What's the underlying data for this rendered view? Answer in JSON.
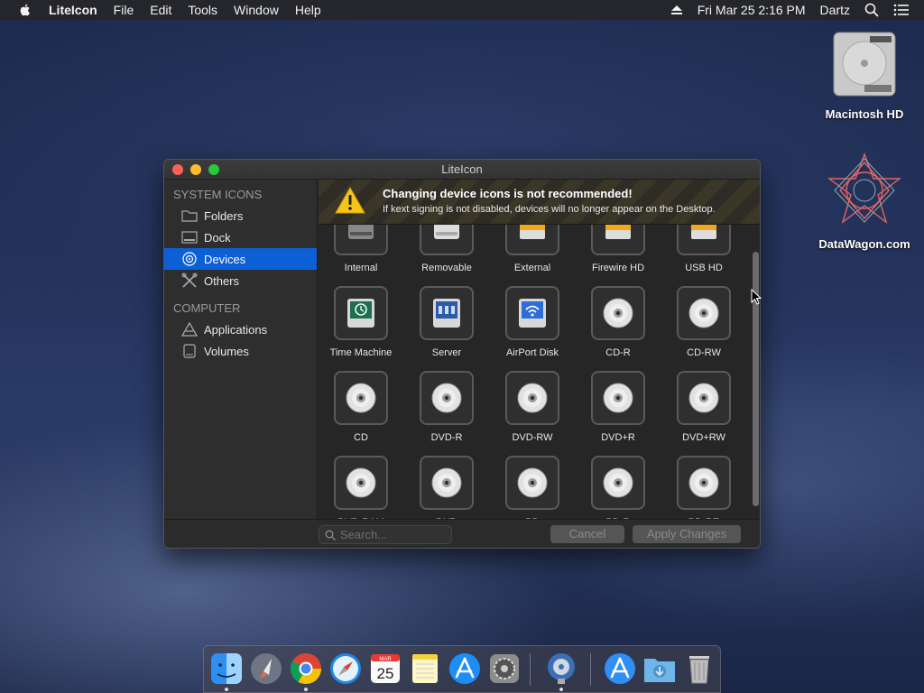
{
  "menubar": {
    "app_name": "LiteIcon",
    "menus": [
      "File",
      "Edit",
      "Tools",
      "Window",
      "Help"
    ],
    "datetime": "Fri Mar 25  2:16 PM",
    "user": "Dartz"
  },
  "desktop": {
    "icons": [
      {
        "label": "Macintosh HD",
        "icon": "hard-drive-icon"
      },
      {
        "label": "DataWagon.com",
        "icon": "geometric-star-icon"
      }
    ]
  },
  "window": {
    "title": "LiteIcon",
    "sidebar": {
      "sections": [
        {
          "header": "SYSTEM ICONS",
          "items": [
            {
              "label": "Folders",
              "icon": "folder-icon"
            },
            {
              "label": "Dock",
              "icon": "dock-icon"
            },
            {
              "label": "Devices",
              "icon": "devices-icon",
              "selected": true
            },
            {
              "label": "Others",
              "icon": "tools-icon"
            }
          ]
        },
        {
          "header": "COMPUTER",
          "items": [
            {
              "label": "Applications",
              "icon": "applications-icon"
            },
            {
              "label": "Volumes",
              "icon": "volumes-icon"
            }
          ]
        }
      ]
    },
    "warning": {
      "title": "Changing device icons is not recommended!",
      "text": "If kext signing is not disabled, devices will no longer appear on the Desktop."
    },
    "devices": [
      {
        "label": "Internal",
        "icon": "internal-drive-icon"
      },
      {
        "label": "Removable",
        "icon": "removable-drive-icon"
      },
      {
        "label": "External",
        "icon": "external-drive-icon"
      },
      {
        "label": "Firewire HD",
        "icon": "firewire-drive-icon"
      },
      {
        "label": "USB HD",
        "icon": "usb-drive-icon"
      },
      {
        "label": "Time Machine",
        "icon": "time-machine-icon"
      },
      {
        "label": "Server",
        "icon": "server-icon"
      },
      {
        "label": "AirPort Disk",
        "icon": "airport-disk-icon"
      },
      {
        "label": "CD-R",
        "icon": "disc-icon",
        "disc": "CD"
      },
      {
        "label": "CD-RW",
        "icon": "disc-icon",
        "disc": "CD"
      },
      {
        "label": "CD",
        "icon": "disc-icon",
        "disc": ""
      },
      {
        "label": "DVD-R",
        "icon": "disc-icon",
        "disc": "DVD"
      },
      {
        "label": "DVD-RW",
        "icon": "disc-icon",
        "disc": "DVD"
      },
      {
        "label": "DVD+R",
        "icon": "disc-icon",
        "disc": "DVD"
      },
      {
        "label": "DVD+RW",
        "icon": "disc-icon",
        "disc": "DVD"
      },
      {
        "label": "DVD-RAM",
        "icon": "disc-icon",
        "disc": "DVD"
      },
      {
        "label": "DVD",
        "icon": "disc-icon",
        "disc": "DVD"
      },
      {
        "label": "BD",
        "icon": "disc-icon",
        "disc": "BD"
      },
      {
        "label": "BD-R",
        "icon": "disc-icon",
        "disc": "BD"
      },
      {
        "label": "BD-RE",
        "icon": "disc-icon",
        "disc": "BD"
      }
    ],
    "search_placeholder": "Search...",
    "cancel_label": "Cancel",
    "apply_label": "Apply Changes"
  },
  "dock": {
    "apps": [
      "Finder",
      "Launchpad",
      "Google Chrome",
      "Safari",
      "Calendar",
      "Notes",
      "App Store",
      "System Preferences",
      "LiteIcon",
      "Applications",
      "Downloads",
      "Trash"
    ],
    "calendar": {
      "month": "MAR",
      "day": "25"
    }
  },
  "colors": {
    "accent": "#0d5fd6",
    "warning_yellow": "#f5c518"
  }
}
